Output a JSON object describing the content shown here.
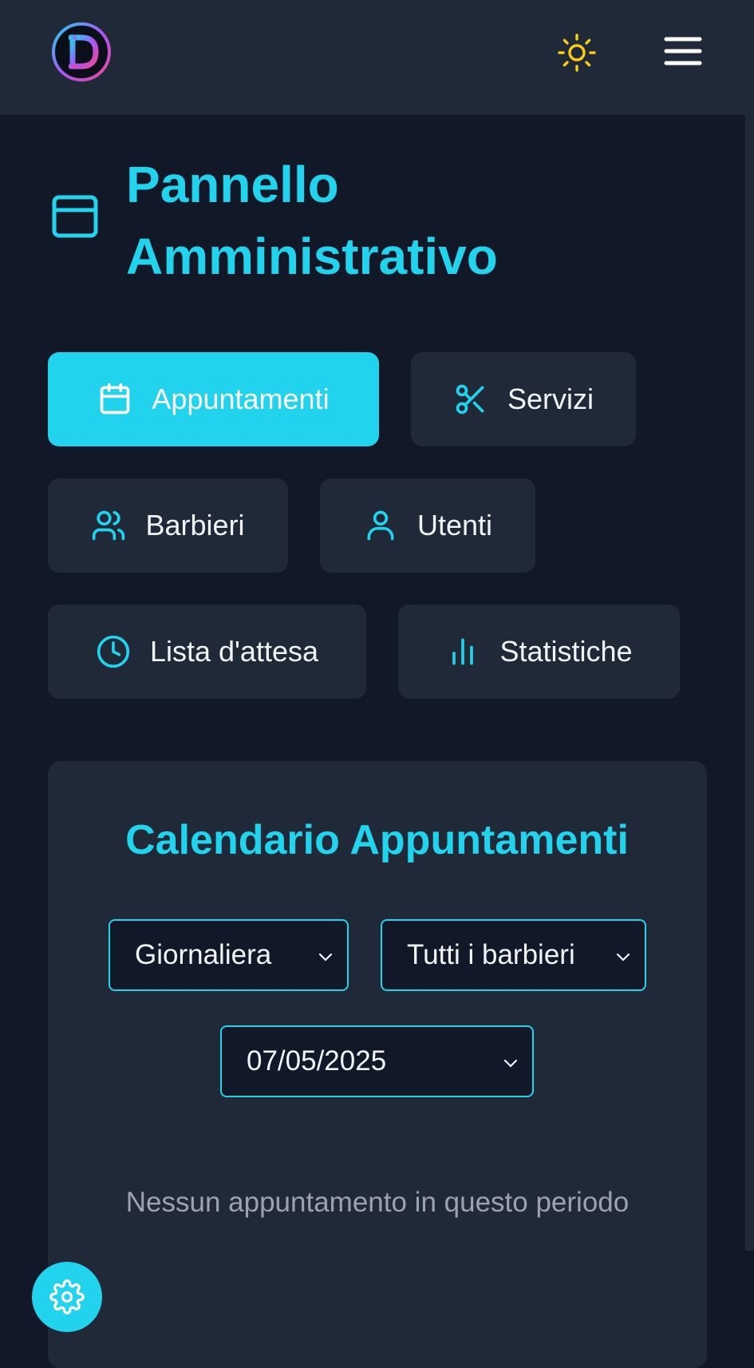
{
  "header": {
    "logo_icon": "logo-d-icon",
    "theme_icon": "sun-icon",
    "menu_icon": "hamburger-menu-icon"
  },
  "page": {
    "title_icon": "browser-window-icon",
    "title_line1": "Pannello",
    "title_line2": "Amministrativo"
  },
  "nav": [
    {
      "label": "Appuntamenti",
      "icon": "calendar-icon",
      "active": true
    },
    {
      "label": "Servizi",
      "icon": "scissors-icon",
      "active": false
    },
    {
      "label": "Barbieri",
      "icon": "users-icon",
      "active": false
    },
    {
      "label": "Utenti",
      "icon": "user-icon",
      "active": false
    },
    {
      "label": "Lista d'attesa",
      "icon": "clock-icon",
      "active": false
    },
    {
      "label": "Statistiche",
      "icon": "bar-chart-icon",
      "active": false
    }
  ],
  "calendar": {
    "title": "Calendario Appuntamenti",
    "view_select": "Giornaliera",
    "barber_select": "Tutti i barbieri",
    "date_select": "07/05/2025",
    "empty_message": "Nessun appuntamento in questo periodo"
  },
  "fab": {
    "icon": "gear-icon"
  },
  "colors": {
    "accent": "#22d3ee",
    "background": "#111827",
    "surface": "#1f2937",
    "sun": "#facc15"
  }
}
